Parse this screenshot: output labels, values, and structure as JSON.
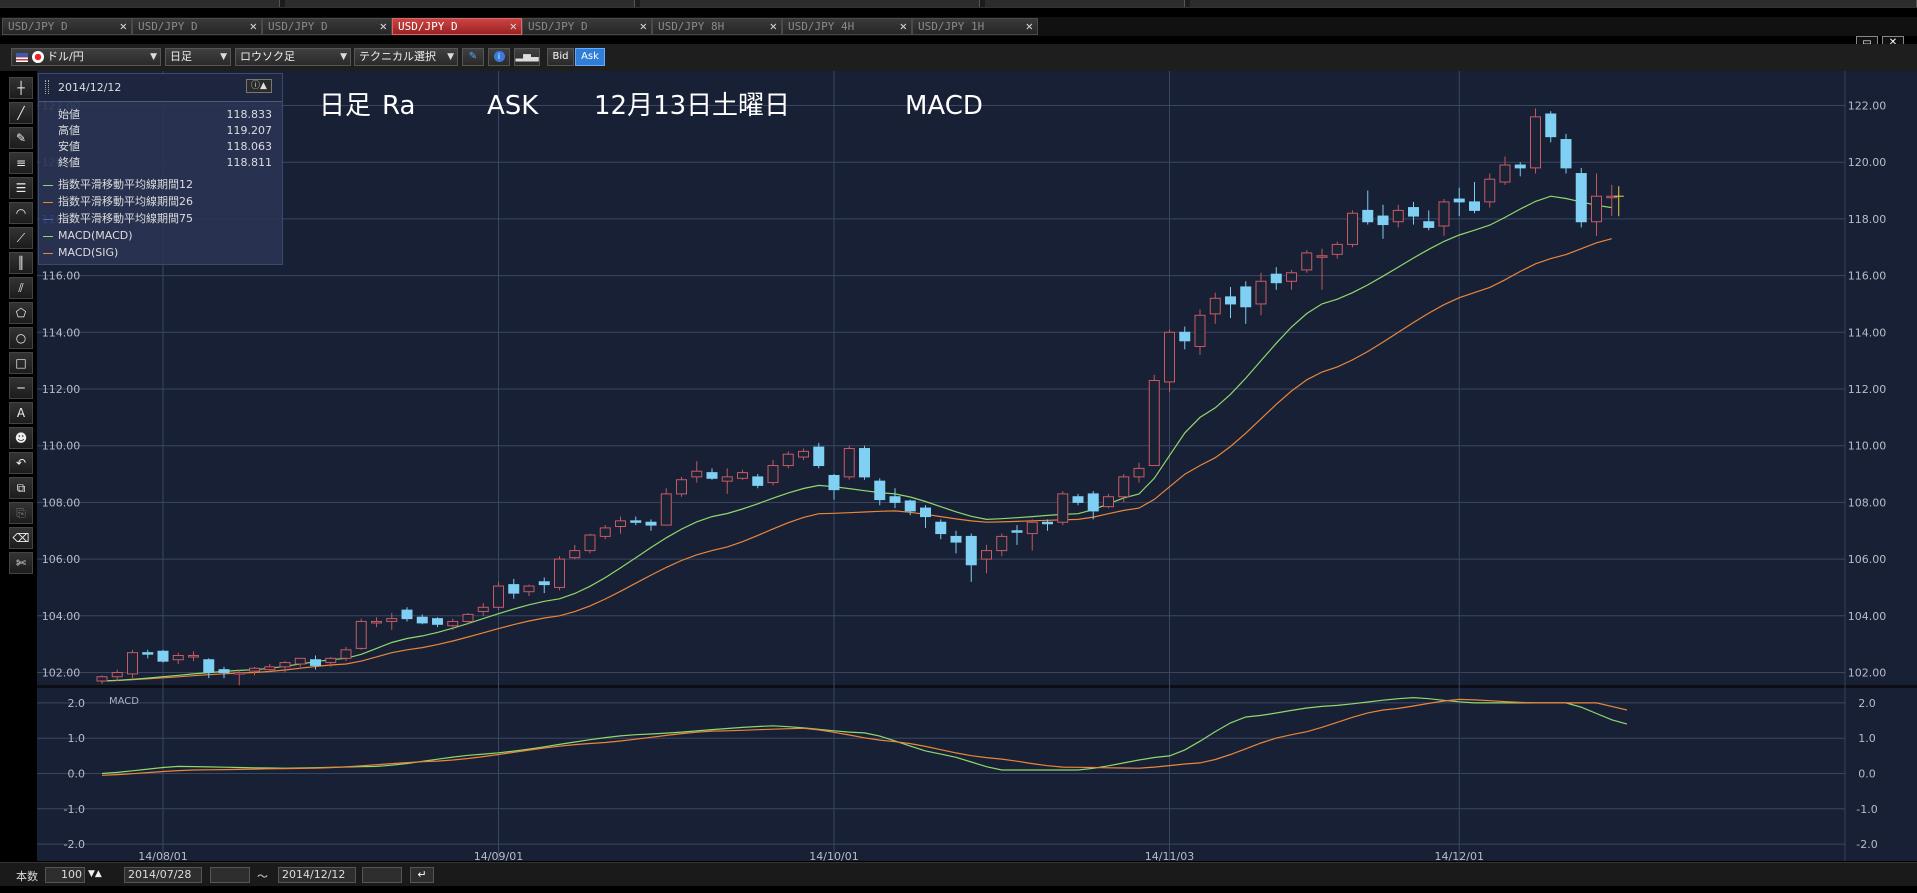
{
  "window": {
    "restore_icon": "restore-icon",
    "close_label": "✕"
  },
  "tabs": [
    {
      "label": "USD/JPY D",
      "active": false
    },
    {
      "label": "USD/JPY D",
      "active": false
    },
    {
      "label": "USD/JPY D",
      "active": false
    },
    {
      "label": "USD/JPY D",
      "active": true
    },
    {
      "label": "USD/JPY D",
      "active": false
    },
    {
      "label": "USD/JPY 8H",
      "active": false
    },
    {
      "label": "USD/JPY 4H",
      "active": false
    },
    {
      "label": "USD/JPY 1H",
      "active": false
    }
  ],
  "tab_close": "✕",
  "toolbar": {
    "pair": "ドル/円",
    "period": "日足",
    "chart_type": "ロウソク足",
    "technical": "テクニカル選択",
    "bid": "Bid",
    "ask": "Ask"
  },
  "info": {
    "date": "2014/12/12",
    "rows": [
      {
        "label": "始値",
        "value": "118.833"
      },
      {
        "label": "高値",
        "value": "119.207"
      },
      {
        "label": "安値",
        "value": "118.063"
      },
      {
        "label": "終値",
        "value": "118.811"
      }
    ],
    "legend": [
      {
        "label": "指数平滑移動平均線期間12",
        "color": "#8fd86a"
      },
      {
        "label": "指数平滑移動平均線期間26",
        "color": "#e8863a"
      },
      {
        "label": "指数平滑移動平均線期間75",
        "color": "#3a6ae8"
      },
      {
        "label": "MACD(MACD)",
        "color": "#8fd86a"
      },
      {
        "label": "MACD(SIG)",
        "color": "#e8863a"
      }
    ]
  },
  "overlay": {
    "a": "日足",
    "b": "Ra",
    "c": "ASK",
    "d": "12月13日",
    "e": "土曜日",
    "f": "MACD"
  },
  "bottom": {
    "count_label": "本数",
    "count": "100",
    "from": "2014/07/28",
    "sep": "～",
    "to": "2014/12/12"
  },
  "chart_data": [
    {
      "type": "candlestick",
      "ylim": [
        101.2,
        122.6
      ],
      "yticks": [
        "102.00",
        "104.00",
        "106.00",
        "108.00",
        "110.00",
        "112.00",
        "114.00",
        "116.00",
        "118.00",
        "120.00",
        "122.00"
      ],
      "xlabels": [
        {
          "label": "14/08/01",
          "index": 4
        },
        {
          "label": "14/09/01",
          "index": 26
        },
        {
          "label": "14/10/01",
          "index": 48
        },
        {
          "label": "14/11/03",
          "index": 70
        },
        {
          "label": "14/12/01",
          "index": 89
        }
      ],
      "candles": [
        [
          101.7,
          101.9,
          101.6,
          101.85
        ],
        [
          101.85,
          102.1,
          101.7,
          102.0
        ],
        [
          101.95,
          102.8,
          101.8,
          102.7
        ],
        [
          102.7,
          102.8,
          102.5,
          102.65
        ],
        [
          102.75,
          102.8,
          102.35,
          102.4
        ],
        [
          102.45,
          102.7,
          102.3,
          102.6
        ],
        [
          102.55,
          102.75,
          102.4,
          102.6
        ],
        [
          102.45,
          102.5,
          101.8,
          102.0
        ],
        [
          102.1,
          102.2,
          101.8,
          102.0
        ],
        [
          102.0,
          102.1,
          101.55,
          102.0
        ],
        [
          102.05,
          102.2,
          101.9,
          102.15
        ],
        [
          102.1,
          102.3,
          102.0,
          102.2
        ],
        [
          102.2,
          102.4,
          102.0,
          102.35
        ],
        [
          102.3,
          102.5,
          102.2,
          102.5
        ],
        [
          102.45,
          102.6,
          102.1,
          102.25
        ],
        [
          102.35,
          102.55,
          102.2,
          102.5
        ],
        [
          102.5,
          102.9,
          102.4,
          102.8
        ],
        [
          102.85,
          103.9,
          102.8,
          103.8
        ],
        [
          103.75,
          103.95,
          103.6,
          103.8
        ],
        [
          103.8,
          104.1,
          103.5,
          103.9
        ],
        [
          104.2,
          104.3,
          103.8,
          103.9
        ],
        [
          103.95,
          104.05,
          103.7,
          103.75
        ],
        [
          103.9,
          103.95,
          103.6,
          103.7
        ],
        [
          103.65,
          103.9,
          103.5,
          103.8
        ],
        [
          103.8,
          104.1,
          103.7,
          104.05
        ],
        [
          104.15,
          104.45,
          104.0,
          104.3
        ],
        [
          104.3,
          105.2,
          104.2,
          105.05
        ],
        [
          105.1,
          105.3,
          104.6,
          104.8
        ],
        [
          104.85,
          105.1,
          104.7,
          105.05
        ],
        [
          105.2,
          105.35,
          104.8,
          105.1
        ],
        [
          105.0,
          106.1,
          104.9,
          106.0
        ],
        [
          106.05,
          106.5,
          106.0,
          106.3
        ],
        [
          106.3,
          106.9,
          106.2,
          106.85
        ],
        [
          106.8,
          107.2,
          106.7,
          107.1
        ],
        [
          107.15,
          107.5,
          106.9,
          107.35
        ],
        [
          107.35,
          107.5,
          107.2,
          107.3
        ],
        [
          107.3,
          107.4,
          107.0,
          107.2
        ],
        [
          107.2,
          108.5,
          107.2,
          108.3
        ],
        [
          108.3,
          108.9,
          108.2,
          108.8
        ],
        [
          108.9,
          109.45,
          108.7,
          109.1
        ],
        [
          109.05,
          109.2,
          108.8,
          108.85
        ],
        [
          108.75,
          109.2,
          108.3,
          108.9
        ],
        [
          108.85,
          109.15,
          108.8,
          109.05
        ],
        [
          108.9,
          109.0,
          108.5,
          108.6
        ],
        [
          108.7,
          109.5,
          108.6,
          109.3
        ],
        [
          109.3,
          109.8,
          109.2,
          109.7
        ],
        [
          109.6,
          109.9,
          109.5,
          109.8
        ],
        [
          109.95,
          110.1,
          109.2,
          109.3
        ],
        [
          108.95,
          109.0,
          108.1,
          108.45
        ],
        [
          108.9,
          110.0,
          108.8,
          109.9
        ],
        [
          109.9,
          110.0,
          108.8,
          108.9
        ],
        [
          108.75,
          108.85,
          107.9,
          108.1
        ],
        [
          108.2,
          108.5,
          107.8,
          108.0
        ],
        [
          108.05,
          108.1,
          107.55,
          107.7
        ],
        [
          107.8,
          107.9,
          107.1,
          107.5
        ],
        [
          107.3,
          107.4,
          106.7,
          106.9
        ],
        [
          106.8,
          107.0,
          106.2,
          106.6
        ],
        [
          106.8,
          106.9,
          105.2,
          105.8
        ],
        [
          106.0,
          106.5,
          105.5,
          106.3
        ],
        [
          106.3,
          106.9,
          106.1,
          106.8
        ],
        [
          107.0,
          107.2,
          106.5,
          106.95
        ],
        [
          106.9,
          107.4,
          106.3,
          107.3
        ],
        [
          107.3,
          107.4,
          107.0,
          107.25
        ],
        [
          107.3,
          108.4,
          107.2,
          108.3
        ],
        [
          108.2,
          108.3,
          107.9,
          108.0
        ],
        [
          108.3,
          108.4,
          107.4,
          107.7
        ],
        [
          107.85,
          108.3,
          107.8,
          108.2
        ],
        [
          108.2,
          109.0,
          108.0,
          108.9
        ],
        [
          108.9,
          109.4,
          108.7,
          109.2
        ],
        [
          109.3,
          112.5,
          109.3,
          112.3
        ],
        [
          112.25,
          114.1,
          111.9,
          114.0
        ],
        [
          114.0,
          114.2,
          113.4,
          113.7
        ],
        [
          113.5,
          114.8,
          113.2,
          114.6
        ],
        [
          114.65,
          115.4,
          114.3,
          115.2
        ],
        [
          115.25,
          115.6,
          114.5,
          115.0
        ],
        [
          115.6,
          115.8,
          114.3,
          114.9
        ],
        [
          115.0,
          116.1,
          114.6,
          115.8
        ],
        [
          116.05,
          116.3,
          115.5,
          115.75
        ],
        [
          115.8,
          116.2,
          115.5,
          116.1
        ],
        [
          116.2,
          116.9,
          116.1,
          116.8
        ],
        [
          116.7,
          116.95,
          115.5,
          116.7
        ],
        [
          116.75,
          117.2,
          116.6,
          117.1
        ],
        [
          117.1,
          118.3,
          117.0,
          118.2
        ],
        [
          118.3,
          119.0,
          117.8,
          117.9
        ],
        [
          118.1,
          118.5,
          117.3,
          117.8
        ],
        [
          117.9,
          118.5,
          117.7,
          118.3
        ],
        [
          118.4,
          118.6,
          117.8,
          118.1
        ],
        [
          117.9,
          118.3,
          117.6,
          117.7
        ],
        [
          117.75,
          118.7,
          117.4,
          118.6
        ],
        [
          118.7,
          119.1,
          118.1,
          118.6
        ],
        [
          118.6,
          119.3,
          118.2,
          118.3
        ],
        [
          118.6,
          119.6,
          118.4,
          119.4
        ],
        [
          119.3,
          120.2,
          119.2,
          119.9
        ],
        [
          119.9,
          120.0,
          119.5,
          119.8
        ],
        [
          119.8,
          121.9,
          119.6,
          121.6
        ],
        [
          121.7,
          121.8,
          120.7,
          120.9
        ],
        [
          120.8,
          121.0,
          119.6,
          119.8
        ],
        [
          119.6,
          119.8,
          117.7,
          117.9
        ],
        [
          117.9,
          119.6,
          117.4,
          118.8
        ],
        [
          118.8,
          119.2,
          118.1,
          118.8
        ]
      ],
      "ema12_knots": [
        [
          0,
          101.7
        ],
        [
          10,
          102.1
        ],
        [
          16,
          102.5
        ],
        [
          20,
          103.2
        ],
        [
          30,
          104.6
        ],
        [
          40,
          107.5
        ],
        [
          47,
          108.6
        ],
        [
          52,
          108.3
        ],
        [
          58,
          107.4
        ],
        [
          64,
          107.6
        ],
        [
          68,
          108.3
        ],
        [
          72,
          111.0
        ],
        [
          80,
          115.0
        ],
        [
          90,
          117.6
        ],
        [
          95,
          118.8
        ],
        [
          99,
          118.4
        ]
      ],
      "ema26_knots": [
        [
          0,
          101.7
        ],
        [
          10,
          102.0
        ],
        [
          16,
          102.3
        ],
        [
          20,
          102.8
        ],
        [
          30,
          104.0
        ],
        [
          40,
          106.3
        ],
        [
          47,
          107.6
        ],
        [
          52,
          107.7
        ],
        [
          58,
          107.3
        ],
        [
          64,
          107.4
        ],
        [
          68,
          107.8
        ],
        [
          72,
          109.3
        ],
        [
          80,
          112.6
        ],
        [
          90,
          115.4
        ],
        [
          95,
          116.6
        ],
        [
          99,
          117.3
        ]
      ]
    },
    {
      "type": "line",
      "title": "MACD",
      "ylim": [
        -2.0,
        2.0
      ],
      "yticks": [
        "2.0",
        "1.0",
        "0.0",
        "-1.0",
        "-2.0"
      ],
      "series": [
        {
          "name": "MACD(MACD)",
          "color": "#8fd86a",
          "knots": [
            [
              0,
              0.0
            ],
            [
              5,
              0.2
            ],
            [
              12,
              0.15
            ],
            [
              18,
              0.2
            ],
            [
              25,
              0.55
            ],
            [
              35,
              1.1
            ],
            [
              44,
              1.35
            ],
            [
              50,
              1.15
            ],
            [
              55,
              0.55
            ],
            [
              59,
              0.1
            ],
            [
              64,
              0.1
            ],
            [
              70,
              0.5
            ],
            [
              75,
              1.6
            ],
            [
              80,
              1.9
            ],
            [
              86,
              2.15
            ],
            [
              90,
              2.0
            ],
            [
              96,
              2.0
            ],
            [
              100,
              1.4
            ]
          ]
        },
        {
          "name": "MACD(SIG)",
          "color": "#e8863a",
          "knots": [
            [
              0,
              -0.05
            ],
            [
              6,
              0.1
            ],
            [
              14,
              0.15
            ],
            [
              22,
              0.35
            ],
            [
              32,
              0.85
            ],
            [
              40,
              1.2
            ],
            [
              46,
              1.28
            ],
            [
              52,
              0.9
            ],
            [
              58,
              0.45
            ],
            [
              63,
              0.18
            ],
            [
              68,
              0.15
            ],
            [
              72,
              0.3
            ],
            [
              78,
              1.1
            ],
            [
              84,
              1.8
            ],
            [
              89,
              2.1
            ],
            [
              94,
              2.0
            ],
            [
              98,
              2.0
            ],
            [
              100,
              1.8
            ]
          ]
        }
      ]
    }
  ]
}
